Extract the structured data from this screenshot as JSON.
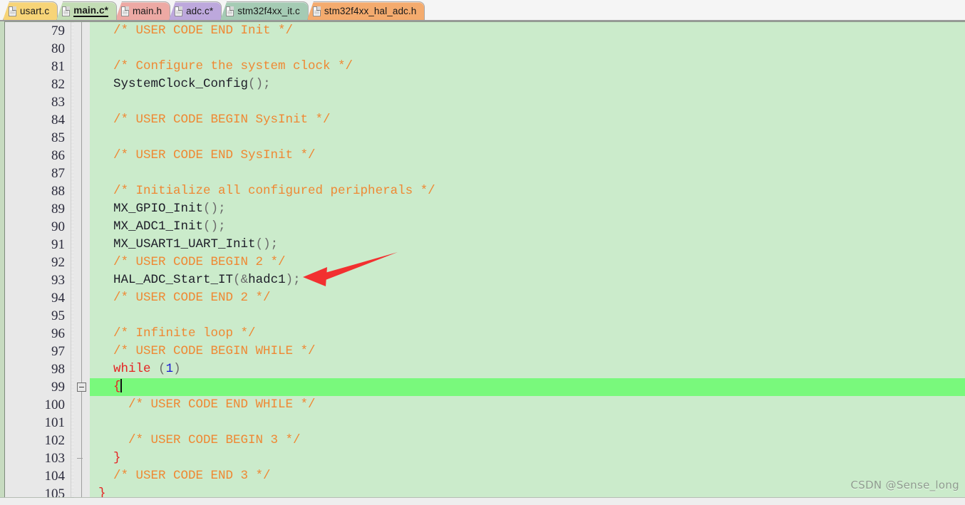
{
  "window": {
    "kind": "code-editor",
    "colors": {
      "code_background": "#cbebcb",
      "gutter_background": "#e8e8e8",
      "current_line_highlight": "#79f97c",
      "comment": "#ef8833",
      "keyword": "#e52222",
      "number": "#1616d6",
      "identifier": "#1d1d28",
      "annotation_arrow": "#f23030"
    }
  },
  "tabbar": {
    "tabs": [
      {
        "label": "usart.c",
        "color": "#f7d477",
        "active": false,
        "icon": "file-icon"
      },
      {
        "label": "main.c*",
        "color": "#c3ddb5",
        "active": true,
        "icon": "file-icon"
      },
      {
        "label": "main.h",
        "color": "#eda9a4",
        "active": false,
        "icon": "file-icon"
      },
      {
        "label": "adc.c*",
        "color": "#bda8dc",
        "active": false,
        "icon": "file-icon"
      },
      {
        "label": "stm32f4xx_it.c",
        "color": "#a5cbb4",
        "active": false,
        "icon": "file-icon"
      },
      {
        "label": "stm32f4xx_hal_adc.h",
        "color": "#f4ab6e",
        "active": false,
        "icon": "file-icon"
      }
    ]
  },
  "editor": {
    "first_line_number": 79,
    "current_line": 99,
    "fold_open_line": 99,
    "fold_end_line": 103,
    "lines": [
      {
        "n": 79,
        "text": "  /* USER CODE END Init */"
      },
      {
        "n": 80,
        "text": ""
      },
      {
        "n": 81,
        "text": "  /* Configure the system clock */"
      },
      {
        "n": 82,
        "text": "  SystemClock_Config();"
      },
      {
        "n": 83,
        "text": ""
      },
      {
        "n": 84,
        "text": "  /* USER CODE BEGIN SysInit */"
      },
      {
        "n": 85,
        "text": ""
      },
      {
        "n": 86,
        "text": "  /* USER CODE END SysInit */"
      },
      {
        "n": 87,
        "text": ""
      },
      {
        "n": 88,
        "text": "  /* Initialize all configured peripherals */"
      },
      {
        "n": 89,
        "text": "  MX_GPIO_Init();"
      },
      {
        "n": 90,
        "text": "  MX_ADC1_Init();"
      },
      {
        "n": 91,
        "text": "  MX_USART1_UART_Init();"
      },
      {
        "n": 92,
        "text": "  /* USER CODE BEGIN 2 */"
      },
      {
        "n": 93,
        "text": "  HAL_ADC_Start_IT(&hadc1);"
      },
      {
        "n": 94,
        "text": "  /* USER CODE END 2 */"
      },
      {
        "n": 95,
        "text": ""
      },
      {
        "n": 96,
        "text": "  /* Infinite loop */"
      },
      {
        "n": 97,
        "text": "  /* USER CODE BEGIN WHILE */"
      },
      {
        "n": 98,
        "text": "  while (1)"
      },
      {
        "n": 99,
        "text": "  {"
      },
      {
        "n": 100,
        "text": "    /* USER CODE END WHILE */"
      },
      {
        "n": 101,
        "text": ""
      },
      {
        "n": 102,
        "text": "    /* USER CODE BEGIN 3 */"
      },
      {
        "n": 103,
        "text": "  }"
      },
      {
        "n": 104,
        "text": "  /* USER CODE END 3 */"
      },
      {
        "n": 105,
        "text": "}"
      }
    ]
  },
  "watermark": {
    "text": "CSDN @Sense_long"
  }
}
